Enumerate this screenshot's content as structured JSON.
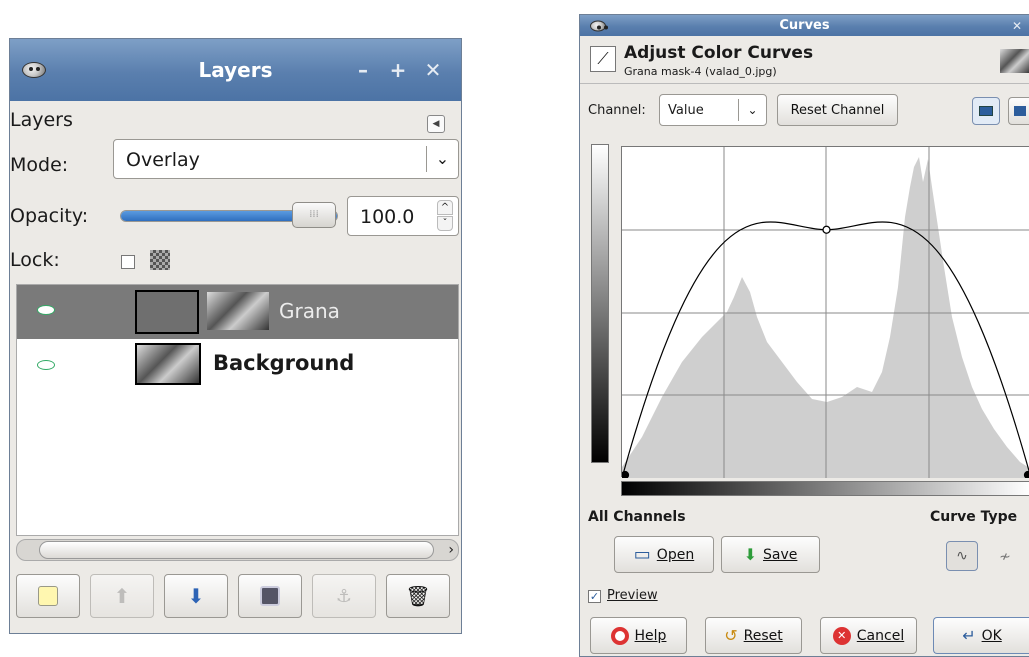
{
  "layers_window": {
    "title": "Layers",
    "panel_label": "Layers",
    "mode_label": "Mode:",
    "mode_value": "Overlay",
    "opacity_label": "Opacity:",
    "opacity_value": "100.0",
    "opacity_level": 1.0,
    "lock_label": "Lock:",
    "layers": [
      {
        "name": "Grana",
        "selected": true,
        "visible": true
      },
      {
        "name": "Background",
        "selected": false,
        "visible": true
      }
    ]
  },
  "curves_window": {
    "title": "Curves",
    "header_title": "Adjust Color Curves",
    "header_subtitle": "Grana mask-4 (valad_0.jpg)",
    "channel_label": "Channel:",
    "channel_value": "Value",
    "reset_channel_label": "Reset Channel",
    "all_channels_label": "All Channels",
    "curve_type_label": "Curve Type",
    "open_label": "Open",
    "save_label": "Save",
    "preview_label": "Preview",
    "preview_checked": true,
    "help_label": "Help",
    "reset_label": "Reset",
    "cancel_label": "Cancel",
    "ok_label": "OK",
    "curve_points": [
      [
        0,
        0
      ],
      [
        0.5,
        0.75
      ],
      [
        1,
        0
      ]
    ]
  },
  "colors": {
    "titlebar": "#5a7fae",
    "selected_row": "#7a7a7a",
    "opacity_fill": "#3a79c8"
  }
}
